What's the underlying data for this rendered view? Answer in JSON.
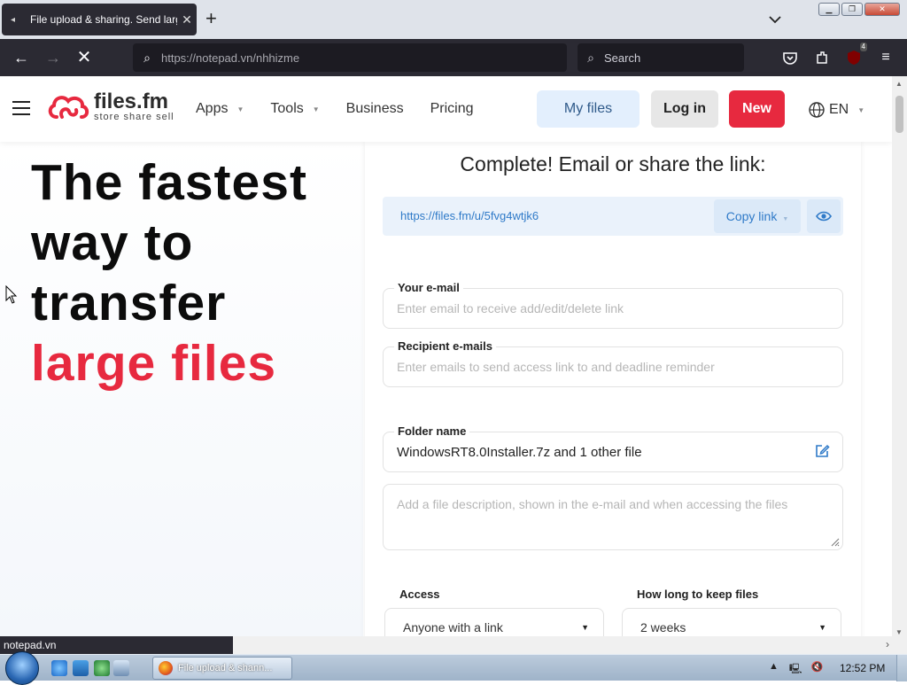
{
  "browser": {
    "tab_title": "File upload & sharing. Send large files",
    "tab_close": "✕",
    "new_tab": "+",
    "url_host": "https://notepad.vn",
    "url_path": "/nhhizme",
    "search_placeholder": "Search",
    "extension_badge": "4",
    "status_text": "notepad.vn"
  },
  "site": {
    "logo_name": "files.fm",
    "logo_tagline": "store share sell",
    "menu": [
      {
        "label": "Apps",
        "has_dropdown": true
      },
      {
        "label": "Tools",
        "has_dropdown": true
      },
      {
        "label": "Business",
        "has_dropdown": false
      },
      {
        "label": "Pricing",
        "has_dropdown": false
      }
    ],
    "my_files": "My files",
    "log_in": "Log in",
    "new": "New",
    "language": "EN"
  },
  "hero": {
    "line1": "The fastest",
    "line2": "way to",
    "line3": "transfer",
    "line4": "large files"
  },
  "panel": {
    "title": "Complete! Email or share the link:",
    "share_link": "https://files.fm/u/5fvg4wtjk6",
    "copy_link": "Copy link",
    "your_email_label": "Your e-mail",
    "your_email_placeholder": "Enter email to receive add/edit/delete link",
    "recipient_label": "Recipient e-mails",
    "recipient_placeholder": "Enter emails to send access link to and deadline reminder",
    "folder_label": "Folder name",
    "folder_value": "WindowsRT8.0Installer.7z and 1 other file",
    "description_placeholder": "Add a file description, shown in the e-mail and when accessing the files",
    "access_label": "Access",
    "access_value": "Anyone with a link",
    "keep_label": "How long to keep files",
    "keep_value": "2 weeks"
  },
  "taskbar": {
    "task_title": "File upload & shann...",
    "clock": "12:52 PM"
  },
  "colors": {
    "brand_red": "#e7293f",
    "link_blue": "#2f7ac8",
    "browser_dark": "#2b2a33"
  }
}
